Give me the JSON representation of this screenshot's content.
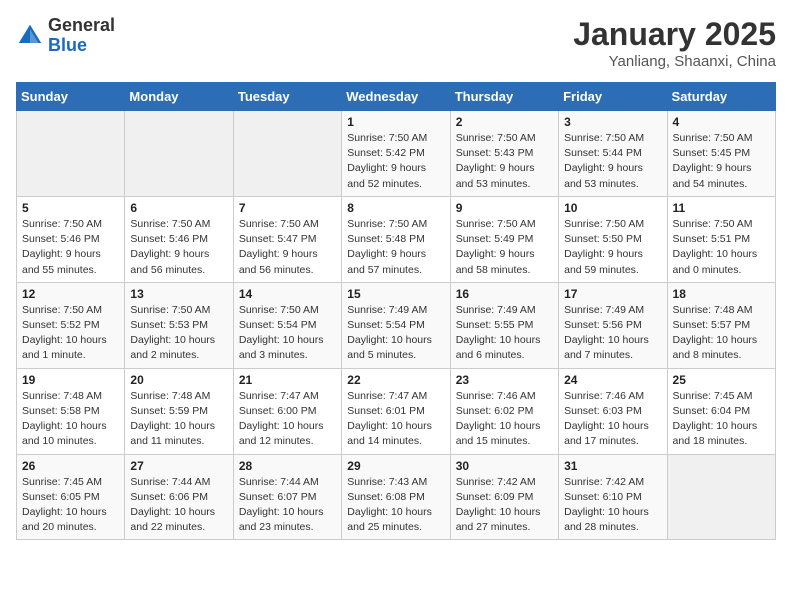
{
  "header": {
    "logo_line1": "General",
    "logo_line2": "Blue",
    "month": "January 2025",
    "location": "Yanliang, Shaanxi, China"
  },
  "weekdays": [
    "Sunday",
    "Monday",
    "Tuesday",
    "Wednesday",
    "Thursday",
    "Friday",
    "Saturday"
  ],
  "weeks": [
    [
      {
        "day": "",
        "info": ""
      },
      {
        "day": "",
        "info": ""
      },
      {
        "day": "",
        "info": ""
      },
      {
        "day": "1",
        "info": "Sunrise: 7:50 AM\nSunset: 5:42 PM\nDaylight: 9 hours\nand 52 minutes."
      },
      {
        "day": "2",
        "info": "Sunrise: 7:50 AM\nSunset: 5:43 PM\nDaylight: 9 hours\nand 53 minutes."
      },
      {
        "day": "3",
        "info": "Sunrise: 7:50 AM\nSunset: 5:44 PM\nDaylight: 9 hours\nand 53 minutes."
      },
      {
        "day": "4",
        "info": "Sunrise: 7:50 AM\nSunset: 5:45 PM\nDaylight: 9 hours\nand 54 minutes."
      }
    ],
    [
      {
        "day": "5",
        "info": "Sunrise: 7:50 AM\nSunset: 5:46 PM\nDaylight: 9 hours\nand 55 minutes."
      },
      {
        "day": "6",
        "info": "Sunrise: 7:50 AM\nSunset: 5:46 PM\nDaylight: 9 hours\nand 56 minutes."
      },
      {
        "day": "7",
        "info": "Sunrise: 7:50 AM\nSunset: 5:47 PM\nDaylight: 9 hours\nand 56 minutes."
      },
      {
        "day": "8",
        "info": "Sunrise: 7:50 AM\nSunset: 5:48 PM\nDaylight: 9 hours\nand 57 minutes."
      },
      {
        "day": "9",
        "info": "Sunrise: 7:50 AM\nSunset: 5:49 PM\nDaylight: 9 hours\nand 58 minutes."
      },
      {
        "day": "10",
        "info": "Sunrise: 7:50 AM\nSunset: 5:50 PM\nDaylight: 9 hours\nand 59 minutes."
      },
      {
        "day": "11",
        "info": "Sunrise: 7:50 AM\nSunset: 5:51 PM\nDaylight: 10 hours\nand 0 minutes."
      }
    ],
    [
      {
        "day": "12",
        "info": "Sunrise: 7:50 AM\nSunset: 5:52 PM\nDaylight: 10 hours\nand 1 minute."
      },
      {
        "day": "13",
        "info": "Sunrise: 7:50 AM\nSunset: 5:53 PM\nDaylight: 10 hours\nand 2 minutes."
      },
      {
        "day": "14",
        "info": "Sunrise: 7:50 AM\nSunset: 5:54 PM\nDaylight: 10 hours\nand 3 minutes."
      },
      {
        "day": "15",
        "info": "Sunrise: 7:49 AM\nSunset: 5:54 PM\nDaylight: 10 hours\nand 5 minutes."
      },
      {
        "day": "16",
        "info": "Sunrise: 7:49 AM\nSunset: 5:55 PM\nDaylight: 10 hours\nand 6 minutes."
      },
      {
        "day": "17",
        "info": "Sunrise: 7:49 AM\nSunset: 5:56 PM\nDaylight: 10 hours\nand 7 minutes."
      },
      {
        "day": "18",
        "info": "Sunrise: 7:48 AM\nSunset: 5:57 PM\nDaylight: 10 hours\nand 8 minutes."
      }
    ],
    [
      {
        "day": "19",
        "info": "Sunrise: 7:48 AM\nSunset: 5:58 PM\nDaylight: 10 hours\nand 10 minutes."
      },
      {
        "day": "20",
        "info": "Sunrise: 7:48 AM\nSunset: 5:59 PM\nDaylight: 10 hours\nand 11 minutes."
      },
      {
        "day": "21",
        "info": "Sunrise: 7:47 AM\nSunset: 6:00 PM\nDaylight: 10 hours\nand 12 minutes."
      },
      {
        "day": "22",
        "info": "Sunrise: 7:47 AM\nSunset: 6:01 PM\nDaylight: 10 hours\nand 14 minutes."
      },
      {
        "day": "23",
        "info": "Sunrise: 7:46 AM\nSunset: 6:02 PM\nDaylight: 10 hours\nand 15 minutes."
      },
      {
        "day": "24",
        "info": "Sunrise: 7:46 AM\nSunset: 6:03 PM\nDaylight: 10 hours\nand 17 minutes."
      },
      {
        "day": "25",
        "info": "Sunrise: 7:45 AM\nSunset: 6:04 PM\nDaylight: 10 hours\nand 18 minutes."
      }
    ],
    [
      {
        "day": "26",
        "info": "Sunrise: 7:45 AM\nSunset: 6:05 PM\nDaylight: 10 hours\nand 20 minutes."
      },
      {
        "day": "27",
        "info": "Sunrise: 7:44 AM\nSunset: 6:06 PM\nDaylight: 10 hours\nand 22 minutes."
      },
      {
        "day": "28",
        "info": "Sunrise: 7:44 AM\nSunset: 6:07 PM\nDaylight: 10 hours\nand 23 minutes."
      },
      {
        "day": "29",
        "info": "Sunrise: 7:43 AM\nSunset: 6:08 PM\nDaylight: 10 hours\nand 25 minutes."
      },
      {
        "day": "30",
        "info": "Sunrise: 7:42 AM\nSunset: 6:09 PM\nDaylight: 10 hours\nand 27 minutes."
      },
      {
        "day": "31",
        "info": "Sunrise: 7:42 AM\nSunset: 6:10 PM\nDaylight: 10 hours\nand 28 minutes."
      },
      {
        "day": "",
        "info": ""
      }
    ]
  ]
}
